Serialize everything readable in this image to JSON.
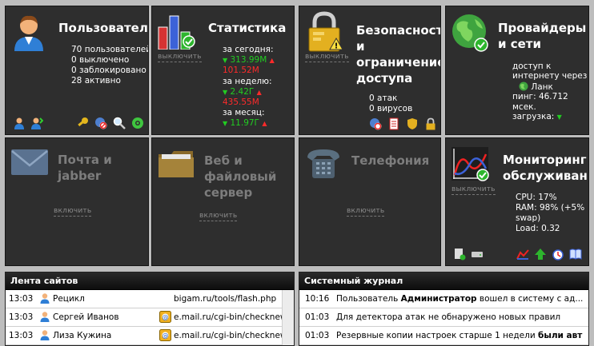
{
  "tiles": {
    "users": {
      "title": "Пользовател",
      "lines": [
        "70 пользователей",
        "0 выключено",
        "0 заблокировано",
        "28 активно"
      ]
    },
    "stats": {
      "title": "Статистика",
      "enable": "выключить",
      "today_label": "за сегодня:",
      "today_up": "313.99M",
      "today_dn": "101.52M",
      "week_label": "за неделю:",
      "week_up": "2.42Г",
      "week_dn": "435.55M",
      "month_label": "за месяц:",
      "month_up": "11.97Г"
    },
    "security": {
      "title1": "Безопасност",
      "title2": "и",
      "title3": "ограничение",
      "title4": "доступа",
      "enable": "выключить",
      "lines": [
        "0 атак",
        "0 вирусов"
      ]
    },
    "providers": {
      "title1": "Провайдеры",
      "title2": "и сети",
      "line1": "доступ к",
      "line2": "интернету через",
      "line3": "Ланк",
      "line4": "пинг: 46.712",
      "line5": "мсек.",
      "line6": "загрузка:"
    },
    "mail": {
      "title1": "Почта и",
      "title2": "jabber",
      "enable": "включить"
    },
    "web": {
      "title1": "Веб и",
      "title2": "файловый",
      "title3": "сервер",
      "enable": "включить"
    },
    "phone": {
      "title": "Телефония",
      "enable": "включить"
    },
    "monitor": {
      "title1": "Мониторинг",
      "title2": "обслуживани",
      "enable": "выключить",
      "cpu": "CPU: 17%",
      "ram1": "RAM: 98% (+5%",
      "ram2": "swap)",
      "load": "Load: 0.32"
    }
  },
  "sites": {
    "title": "Лента сайтов",
    "rows": [
      {
        "time": "13:03",
        "user": "Рецикл",
        "url": "bigam.ru/tools/flash.php",
        "icon": false
      },
      {
        "time": "13:03",
        "user": "Сергей Иванов",
        "url": "e.mail.ru/cgi-bin/checknew",
        "icon": true
      },
      {
        "time": "13:03",
        "user": "Лиза Кужина",
        "url": "e.mail.ru/cgi-bin/checknew",
        "icon": true
      }
    ]
  },
  "log": {
    "title": "Системный журнал",
    "rows": [
      {
        "time": "10:16",
        "pre": "Пользователь ",
        "bold": "Администратор",
        "post": " вошел в систему с ад..."
      },
      {
        "time": "01:03",
        "pre": "Для детектора атак не обнаружено новых правил",
        "bold": "",
        "post": ""
      },
      {
        "time": "01:03",
        "pre": "Резервные копии настроек старше 1 недели ",
        "bold": "были авт...",
        "post": ""
      }
    ]
  },
  "colors": {
    "tile_bg": "#2e2e2e",
    "up": "#22cc22",
    "down": "#ff2a2a",
    "disabled_text": "#7d7d7d"
  }
}
